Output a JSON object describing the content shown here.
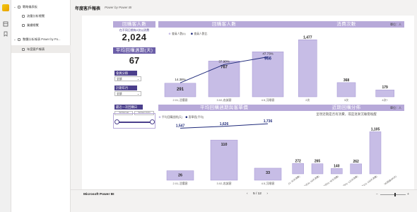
{
  "nav": {
    "items": [
      {
        "label": "戰略儀表板",
        "type": "group"
      },
      {
        "label": "流量分析總覽",
        "type": "page"
      },
      {
        "label": "業績總覽",
        "type": "page"
      },
      {
        "label": "整體分析報表 Power by Po...",
        "type": "group"
      },
      {
        "label": "年度客戶報表",
        "type": "page"
      }
    ]
  },
  "header": {
    "title": "年度客戶報表",
    "subtitle": "Power by Power BI"
  },
  "filters": {
    "title": "回購客人數",
    "caption": "在不同日期有2次以消費",
    "big_value": "2,024",
    "cycle_label": "平均回購週期(天)",
    "cycle_value": "67",
    "member_label": "會員分群",
    "member_value": "全部",
    "period_label": "計期年月",
    "period_value": "全部",
    "last_label": "最近一次回購日",
    "date_from": "2020/1/6",
    "date_to": "2020/12/31"
  },
  "panels": {
    "repurchase_title": "回購客人數",
    "freq_title": "消費次數",
    "freq_unit": "單位：人",
    "cycle_title": "平均回購週期與客單價",
    "recent_title": "近期回購分佈",
    "recent_unit": "單位：人",
    "recent_caption": "呈現近期是否有消費，或是逐漸沉睡需喚醒"
  },
  "colors": {
    "bar": "#c7bde6",
    "bar_stroke": "#a395d2",
    "line": "#1f2a7a",
    "header": "#b7a9d9",
    "accent_dark": "#4b3f8c"
  },
  "chart_data": [
    {
      "type": "bar",
      "title": "回購客人數",
      "legend": [
        "會員人數(k)",
        "會員人數比"
      ],
      "categories": [
        "2.01,活躍客",
        "3.02,忠誠客",
        "4.5,沉睡客"
      ],
      "series": [
        {
          "name": "會員人數(k)",
          "type": "bar",
          "values": [
            291,
            767,
            966
          ]
        },
        {
          "name": "會員人數比",
          "type": "line",
          "values": [
            14.38,
            37.9,
            47.73
          ],
          "labels": [
            "14.38%",
            "37.90%",
            "47.73%"
          ]
        }
      ]
    },
    {
      "type": "bar",
      "title": "消費次數",
      "categories": [
        "2次",
        "3次",
        "4次+"
      ],
      "values": [
        1477,
        368,
        179
      ]
    },
    {
      "type": "bar",
      "title": "平均回購週期與客單價",
      "legend": [
        "平均回購週期(天)",
        "客單價(平均)"
      ],
      "categories": [
        "2.01,活躍客",
        "3.02,忠誠客",
        "4.5,沉睡客"
      ],
      "series": [
        {
          "name": "平均回購週期(天)",
          "type": "bar",
          "values": [
            26,
            110,
            33
          ]
        },
        {
          "name": "客單價(平均)",
          "type": "line",
          "values": [
            1547,
            1626,
            1736
          ]
        }
      ]
    },
    {
      "type": "bar",
      "title": "近期回購分佈",
      "categories": [
        "01(最近1~30天消費)",
        "02(近31~60天消費)",
        "03(近61~90天消費)",
        "04(近91~120天消費)",
        "05(近121~180天消費)",
        "06(超過180天)"
      ],
      "values": [
        272,
        265,
        140,
        262,
        1105
      ]
    }
  ],
  "footer": {
    "brand": "Microsoft Power BI",
    "prev": "‹",
    "page": "5 / 12",
    "next": "›",
    "zoom_minus": "−",
    "zoom_plus": "+"
  }
}
